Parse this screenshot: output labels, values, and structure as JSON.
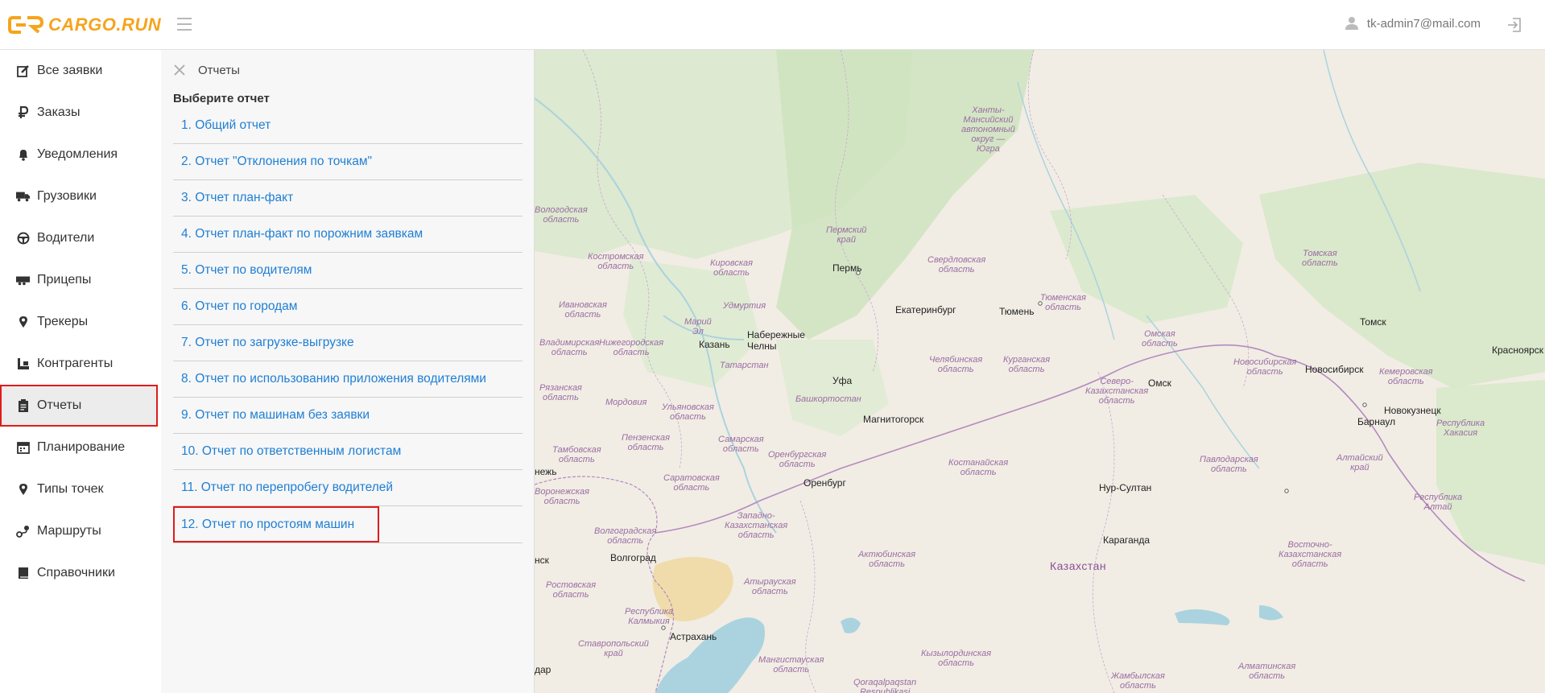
{
  "header": {
    "logo_text": "CARGO.RUN",
    "user_email": "tk-admin7@mail.com",
    "accent_color": "#f5a41c"
  },
  "sidebar": {
    "items": [
      {
        "label": "Все заявки",
        "icon": "edit-icon"
      },
      {
        "label": "Заказы",
        "icon": "ruble-icon"
      },
      {
        "label": "Уведомления",
        "icon": "bell-icon"
      },
      {
        "label": "Грузовики",
        "icon": "truck-icon"
      },
      {
        "label": "Водители",
        "icon": "steering-wheel-icon"
      },
      {
        "label": "Прицепы",
        "icon": "trailer-icon"
      },
      {
        "label": "Трекеры",
        "icon": "map-pin-icon"
      },
      {
        "label": "Контрагенты",
        "icon": "contractors-icon"
      },
      {
        "label": "Отчеты",
        "icon": "clipboard-icon",
        "active": true
      },
      {
        "label": "Планирование",
        "icon": "calendar-icon"
      },
      {
        "label": "Типы точек",
        "icon": "map-pin-icon"
      },
      {
        "label": "Маршруты",
        "icon": "route-icon"
      },
      {
        "label": "Справочники",
        "icon": "book-icon"
      }
    ]
  },
  "panel": {
    "title": "Отчеты",
    "subtitle": "Выберите отчет",
    "reports": [
      "1. Общий отчет",
      "2. Отчет \"Отклонения по точкам\"",
      "3. Отчет план-факт",
      "4. Отчет план-факт по порожним заявкам",
      "5. Отчет по водителям",
      "6. Отчет по городам",
      "7. Отчет по загрузке-выгрузке",
      "8. Отчет по использованию приложения водителями",
      "9. Отчет по машинам без заявки",
      "10. Отчет по ответственным логистам",
      "11. Отчет по перепробегу водителей",
      "12. Отчет по простоям машин"
    ]
  },
  "map": {
    "regions": [
      "Ханты-Мансийский автономный округ — Югра",
      "Вологодская область",
      "Костромская область",
      "Кировская область",
      "Пермский край",
      "Свердловская область",
      "Тюменская область",
      "Томская область",
      "Ивановская область",
      "Удмуртия",
      "Марий Эл",
      "Нижегородская область",
      "Владимирская область",
      "Татарстан",
      "Челябинская область",
      "Курганская область",
      "Омская область",
      "Новосибирская область",
      "Кемеровская область",
      "Рязанская область",
      "Мордовия",
      "Ульяновская область",
      "Башкортостан",
      "Северо-Казахстанская область",
      "Пензенская область",
      "Самарская область",
      "Тамбовская область",
      "Оренбургская область",
      "Костанайская область",
      "Павлодарская область",
      "Алтайский край",
      "Республика Хакасия",
      "Саратовская область",
      "Воронежская область",
      "Западно-Казахстанская область",
      "Республика Алтай",
      "Волгоградская область",
      "Актюбинская область",
      "Восточно-Казахстанская область",
      "Ростовская область",
      "Атырауская область",
      "Республика Калмыкия",
      "Ставропольский край",
      "Мангистауская область",
      "Кызылординская область",
      "Qoraqalpaqstan Respublikasi",
      "Жамбылская область",
      "Алматинская область"
    ],
    "cities": [
      "Пермь",
      "Екатеринбург",
      "Тюмень",
      "Томск",
      "Казань",
      "Набережные Челны",
      "Уфа",
      "Магнитогорск",
      "Омск",
      "Новосибирск",
      "Красноярск",
      "Новокузнецк",
      "Барнаул",
      "Оренбург",
      "Нур-Султан",
      "Караганда",
      "Волгоград",
      "Астрахань",
      "Казахстан"
    ],
    "edge_fragments": [
      "нежь",
      "нск",
      "дар"
    ]
  }
}
